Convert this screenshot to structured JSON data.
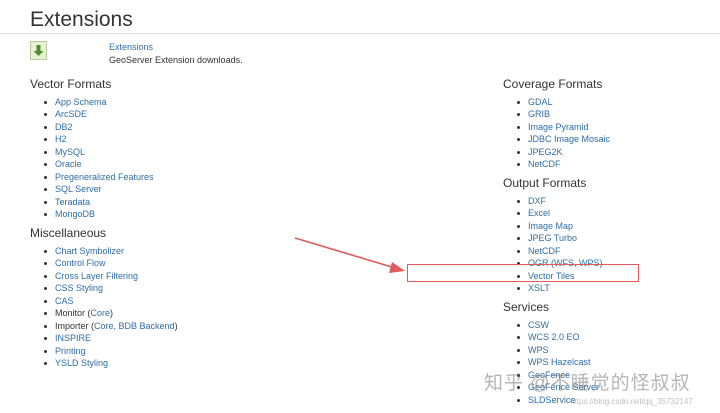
{
  "page": {
    "title": "Extensions"
  },
  "extension_header": {
    "link_label": "Extensions",
    "description": "GeoServer Extension downloads."
  },
  "vector_formats": {
    "heading": "Vector Formats",
    "items": [
      "App Schema",
      "ArcSDE",
      "DB2",
      "H2",
      "MySQL",
      "Oracle",
      "Pregeneralized Features",
      "SQL Server",
      "Teradata",
      "MongoDB"
    ]
  },
  "miscellaneous": {
    "heading": "Miscellaneous",
    "items": [
      {
        "label": "Chart Symbolizer"
      },
      {
        "label": "Control Flow"
      },
      {
        "label": "Cross Layer Filtering"
      },
      {
        "label": "CSS Styling"
      },
      {
        "label": "CAS"
      },
      {
        "prefix": "Monitor (",
        "link": "Core",
        "suffix": ")"
      },
      {
        "prefix": "Importer (",
        "link": "Core, BDB Backend",
        "suffix": ")"
      },
      {
        "label": "INSPIRE"
      },
      {
        "label": "Printing"
      },
      {
        "label": "YSLD Styling"
      }
    ]
  },
  "coverage_formats": {
    "heading": "Coverage Formats",
    "items": [
      "GDAL",
      "GRIB",
      "Image Pyramid",
      "JDBC Image Mosaic",
      "JPEG2K",
      "NetCDF"
    ]
  },
  "output_formats": {
    "heading": "Output Formats",
    "items": [
      "DXF",
      "Excel",
      "Image Map",
      "JPEG Turbo",
      "NetCDF",
      "OGR (WFS, WPS)",
      "Vector Tiles",
      "XSLT"
    ]
  },
  "services": {
    "heading": "Services",
    "items": [
      "CSW",
      "WCS 2.0 EO",
      "WPS",
      "WPS Hazelcast",
      "GeoFence",
      "GeoFence Server",
      "SLDService"
    ]
  },
  "annotation": {
    "color": "#e05a5a"
  },
  "watermark": {
    "text": "知乎 @不睡觉的怪叔叔",
    "url": "https://blog.csdn.net/qq_35732147"
  },
  "colors": {
    "link": "#2f6ea4",
    "text": "#333333"
  }
}
